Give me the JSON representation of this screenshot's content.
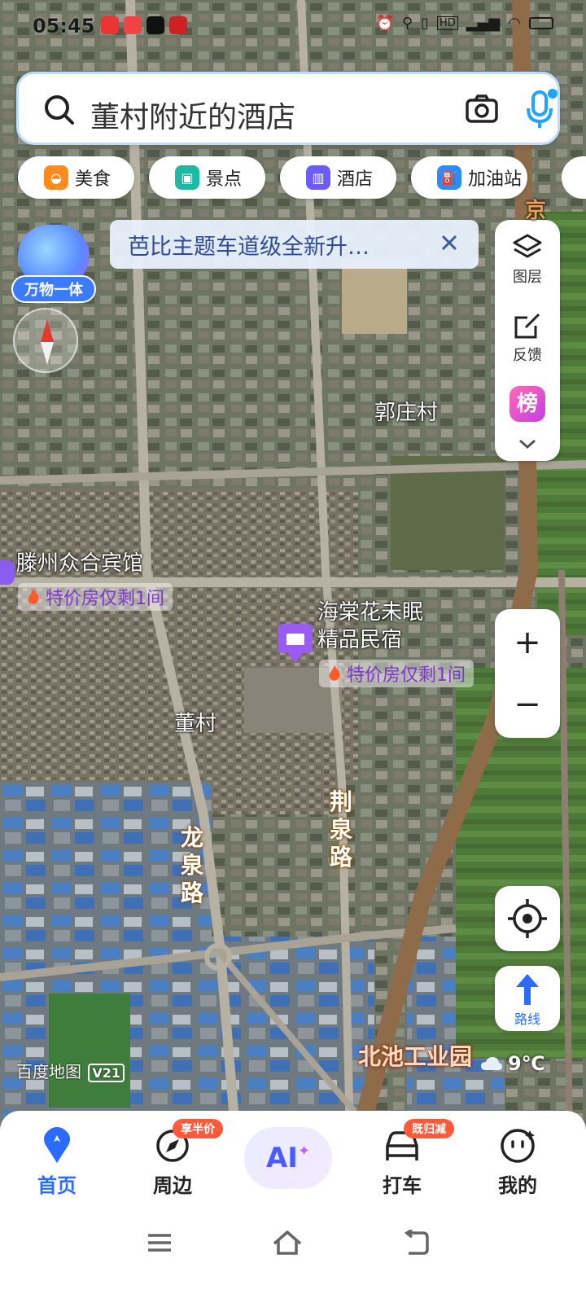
{
  "status_bar": {
    "time": "05:45",
    "icons": [
      "alarm-icon",
      "location-icon",
      "vibrate-icon",
      "hd-icon",
      "signal-icon",
      "wifi-icon",
      "battery-icon"
    ]
  },
  "search": {
    "query": "董村附近的酒店"
  },
  "chips": [
    {
      "label": "美食",
      "icon": "food-icon",
      "color": "#ff8a1e"
    },
    {
      "label": "景点",
      "icon": "scenic-icon",
      "color": "#1fb8a0"
    },
    {
      "label": "酒店",
      "icon": "hotel-icon",
      "color": "#6b5cff"
    },
    {
      "label": "加油站",
      "icon": "gas-station-icon",
      "color": "#2a8cff"
    }
  ],
  "notice": {
    "text": "芭比主题车道级全新升…"
  },
  "badge": {
    "label": "万物一体"
  },
  "tools": {
    "layers": "图层",
    "feedback": "反馈",
    "ranking_partial": "榜"
  },
  "route": {
    "label": "路线"
  },
  "map_labels": {
    "village_guozhuang": "郭庄村",
    "village_dongcun": "董村",
    "road_longquan": "龙泉路",
    "road_jingquan": "荆泉路",
    "industrial_park": "北池工业园",
    "top_partial": "京"
  },
  "pois": [
    {
      "name": "滕州众合宾馆",
      "promo": "特价房仅剩1间"
    },
    {
      "name": "海棠花未眠精品民宿",
      "name_line1": "海棠花未眠",
      "name_line2": "精品民宿",
      "promo": "特价房仅剩1间"
    }
  ],
  "map_brand": "百度地图",
  "map_brand_version": "V21",
  "weather": {
    "temp": "9℃",
    "icon": "cloud-icon"
  },
  "bottom_nav": [
    {
      "label": "首页",
      "active": true,
      "icon": "home-pin-icon"
    },
    {
      "label": "周边",
      "active": false,
      "icon": "compass-icon",
      "badge": "享半价"
    },
    {
      "label": "AI",
      "active": false,
      "icon": "ai-icon"
    },
    {
      "label": "打车",
      "active": false,
      "icon": "car-icon",
      "badge": "既归减"
    },
    {
      "label": "我的",
      "active": false,
      "icon": "profile-icon"
    }
  ],
  "colors": {
    "accent": "#2a6cff",
    "promo": "#7a38c9",
    "road_label": "#8a4a00"
  }
}
